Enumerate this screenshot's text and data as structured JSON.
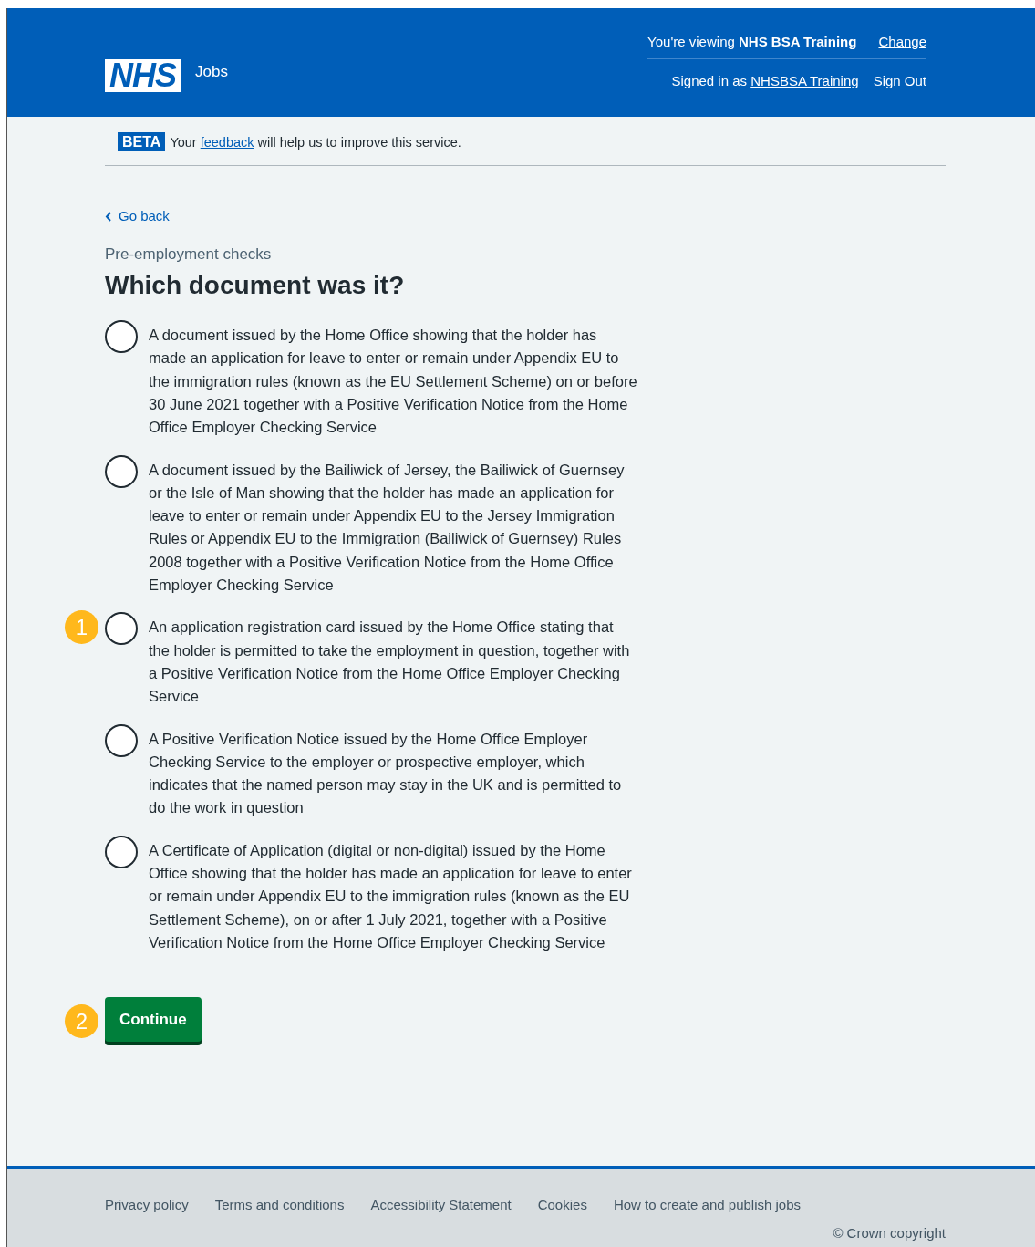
{
  "header": {
    "logo": "NHS",
    "service": "Jobs",
    "viewing_prefix": "You're viewing",
    "viewing_org": "NHS BSA Training",
    "change_link": "Change",
    "signed_in_prefix": "Signed in as",
    "user_link": "NHSBSA Training",
    "sign_out": "Sign Out"
  },
  "beta": {
    "tag": "BETA",
    "before": "Your",
    "link": "feedback",
    "after": "will help us to improve this service."
  },
  "back_link": "Go back",
  "caption": "Pre-employment checks",
  "title": "Which document was it?",
  "options": [
    {
      "label": "A document issued by the Home Office showing that the holder has made an application for leave to enter or remain under Appendix EU to the immigration rules (known as the EU Settlement Scheme) on or before 30 June 2021 together with a Positive Verification Notice from the Home Office Employer Checking Service",
      "selected": false
    },
    {
      "label": "A document issued by the Bailiwick of Jersey, the Bailiwick of Guernsey or the Isle of Man showing that the holder has made an application for leave to enter or remain under Appendix EU to the Jersey Immigration Rules or Appendix EU to the Immigration (Bailiwick of Guernsey) Rules 2008 together with a Positive Verification Notice from the Home Office Employer Checking Service",
      "selected": false
    },
    {
      "label": "An application registration card issued by the Home Office stating that the holder is permitted to take the employment in question, together with a Positive Verification Notice from the Home Office Employer Checking Service",
      "selected": false,
      "callout": "1"
    },
    {
      "label": "A Positive Verification Notice issued by the Home Office Employer Checking Service to the employer or prospective employer, which indicates that the named person may stay in the UK and is permitted to do the work in question",
      "selected": false
    },
    {
      "label": "A Certificate of Application (digital or non-digital) issued by the Home Office showing that the holder has made an application for leave to enter or remain under Appendix EU to the immigration rules (known as the EU Settlement Scheme), on or after 1 July 2021, together with a Positive Verification Notice from the Home Office Employer Checking Service",
      "selected": false
    }
  ],
  "continue": {
    "label": "Continue",
    "callout": "2"
  },
  "footer": {
    "links": [
      "Privacy policy",
      "Terms and conditions",
      "Accessibility Statement",
      "Cookies",
      "How to create and publish jobs"
    ],
    "copyright": "© Crown copyright"
  }
}
